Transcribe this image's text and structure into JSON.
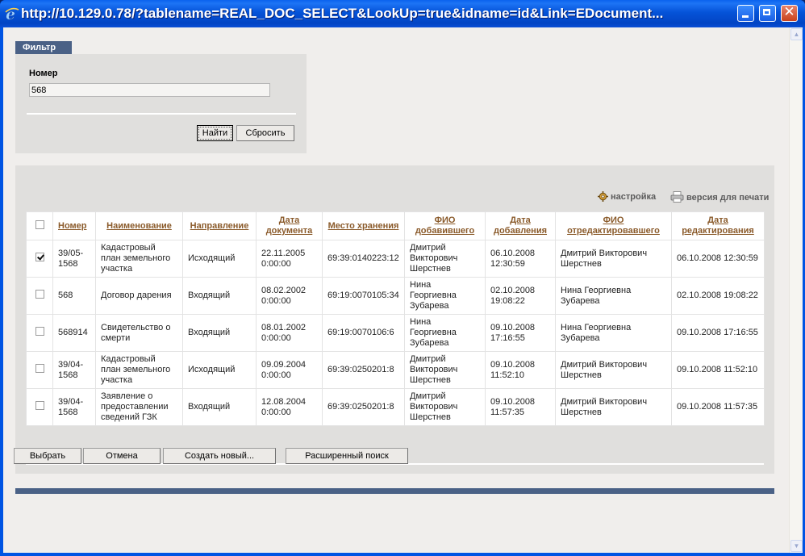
{
  "window": {
    "title": "http://10.129.0.78/?tablename=REAL_DOC_SELECT&LookUp=true&idname=id&Link=EDocument..."
  },
  "filter": {
    "tab_label": "Фильтр",
    "field_label": "Номер",
    "field_value": "568",
    "find_button": "Найти",
    "reset_button": "Сбросить"
  },
  "toolbar": {
    "settings": "настройка",
    "print_version": "версия для печати"
  },
  "table": {
    "headers": {
      "number": "Номер",
      "name": "Наименование",
      "direction": "Направление",
      "doc_date": "Дата документа",
      "location": "Место хранения",
      "added_by": "ФИО добавившего",
      "added_date": "Дата добавления",
      "edited_by": "ФИО отредактировавшего",
      "edited_date": "Дата редактирования"
    },
    "rows": [
      {
        "checked": true,
        "number": "39/05-1568",
        "name": "Кадастровый план земельного участка",
        "direction": "Исходящий",
        "doc_date": "22.11.2005 0:00:00",
        "location": "69:39:0140223:12",
        "added_by": "Дмитрий Викторович Шерстнев",
        "added_date": "06.10.2008 12:30:59",
        "edited_by": "Дмитрий Викторович Шерстнев",
        "edited_date": "06.10.2008 12:30:59"
      },
      {
        "checked": false,
        "number": "568",
        "name": "Договор дарения",
        "direction": "Входящий",
        "doc_date": "08.02.2002 0:00:00",
        "location": "69:19:0070105:34",
        "added_by": "Нина Георгиевна Зубарева",
        "added_date": "02.10.2008 19:08:22",
        "edited_by": "Нина Георгиевна Зубарева",
        "edited_date": "02.10.2008 19:08:22"
      },
      {
        "checked": false,
        "number": "568914",
        "name": "Свидетельство о смерти",
        "direction": "Входящий",
        "doc_date": "08.01.2002 0:00:00",
        "location": "69:19:0070106:6",
        "added_by": "Нина Георгиевна Зубарева",
        "added_date": "09.10.2008 17:16:55",
        "edited_by": "Нина Георгиевна Зубарева",
        "edited_date": "09.10.2008 17:16:55"
      },
      {
        "checked": false,
        "number": "39/04-1568",
        "name": "Кадастровый план земельного участка",
        "direction": "Исходящий",
        "doc_date": "09.09.2004 0:00:00",
        "location": "69:39:0250201:8",
        "added_by": "Дмитрий Викторович Шерстнев",
        "added_date": "09.10.2008 11:52:10",
        "edited_by": "Дмитрий Викторович Шерстнев",
        "edited_date": "09.10.2008 11:52:10"
      },
      {
        "checked": false,
        "number": "39/04-1568",
        "name": "Заявление о предоставлении сведений ГЗК",
        "direction": "Входящий",
        "doc_date": "12.08.2004 0:00:00",
        "location": "69:39:0250201:8",
        "added_by": "Дмитрий Викторович Шерстнев",
        "added_date": "09.10.2008 11:57:35",
        "edited_by": "Дмитрий Викторович Шерстнев",
        "edited_date": "09.10.2008 11:57:35"
      }
    ]
  },
  "actions": {
    "select": "Выбрать",
    "cancel": "Отмена",
    "create_new": "Создать новый...",
    "advanced_search": "Расширенный поиск"
  }
}
